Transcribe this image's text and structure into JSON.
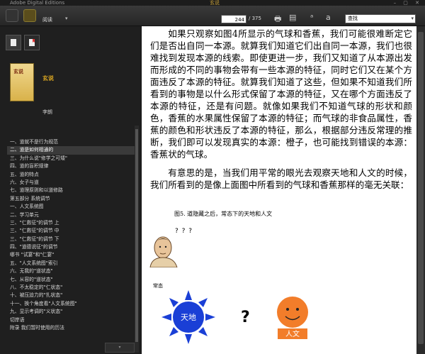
{
  "titlebar": {
    "app": "Adobe Digital Editions",
    "doc": "玄说"
  },
  "toolbar": {
    "mode_label": "阅读",
    "page_current": "244",
    "page_total": "/ 375",
    "search_placeholder": "查找"
  },
  "book": {
    "title": "玄说",
    "author": "李朗"
  },
  "toc": [
    "一、道就不是行为规范",
    "二、道是如何相通的",
    "三、为什么说\"修学之可矮\"",
    "四、道的盲积规律",
    "五、道的特点",
    "六、女子与道",
    "七、道理原则和以道修路",
    "第五部分 系统调节",
    "一、人文系统图",
    "二、学习单元",
    "三、\"仁救征\"的调节 上",
    "三、\"仁救征\"的调节 中",
    "三、\"仁救征\"的调节 下",
    "四、\"道德说征\"的调节",
    "哪书 \"试宴\"和\"仁宴\"",
    "五、\"人文系统图\"索引",
    "六、无我的\"道状态\"",
    "七、从容的\"道状态\"",
    "八、不太稳定的\"仁状态\"",
    "十、被压迫力的\"扎状态\"",
    "十一、换个角度看\"人文系统图\"",
    "九、显示考调的\"义状态\"",
    "切岸语",
    "附录 我们暂时使用的历法"
  ],
  "page": {
    "para1": "如果只观察如图4所显示的气球和香蕉，我们可能很难断定它们是否出自同一本源。就算我们知道它们出自同一本源，我们也很难找到发现本源的线索。即使更进一步，我们又知道了从本源出发而形成的不同的事物会带有一些本源的特征，同时它们又在某个方面违反了本源的特征。就算我们知道了这些，但如果不知道我们所看到的事物是以什么形式保留了本源的特征，又在哪个方面违反了本源的特征，还是有问题。就像如果我们不知道气球的形状和颜色，香蕉的水果属性保留了本源的特征；而气球的非食品属性，香蕉的颜色和形状违反了本源的特征，那么，根据部分违反常理的推断，我们即可以发现真实的本源：橙子，也可能找到错误的本源：香蕉状的气球。",
    "para2": "有意思的是，当我们用平常的眼光去观察天地和人文的时候，我们所看到的是像上面图中所看到的气球和香蕉那样的毫无关联：",
    "figure": {
      "caption": "图5. 道隐藏之后，常态下的天地和人文",
      "qmarks": "? ? ?",
      "label": "常态",
      "sun_label": "天地",
      "center_mark": "?",
      "orange_label": "人文"
    }
  },
  "colors": {
    "accent": "#d9a521",
    "sun": "#1a3fd6",
    "orange": "#f27d2a"
  }
}
